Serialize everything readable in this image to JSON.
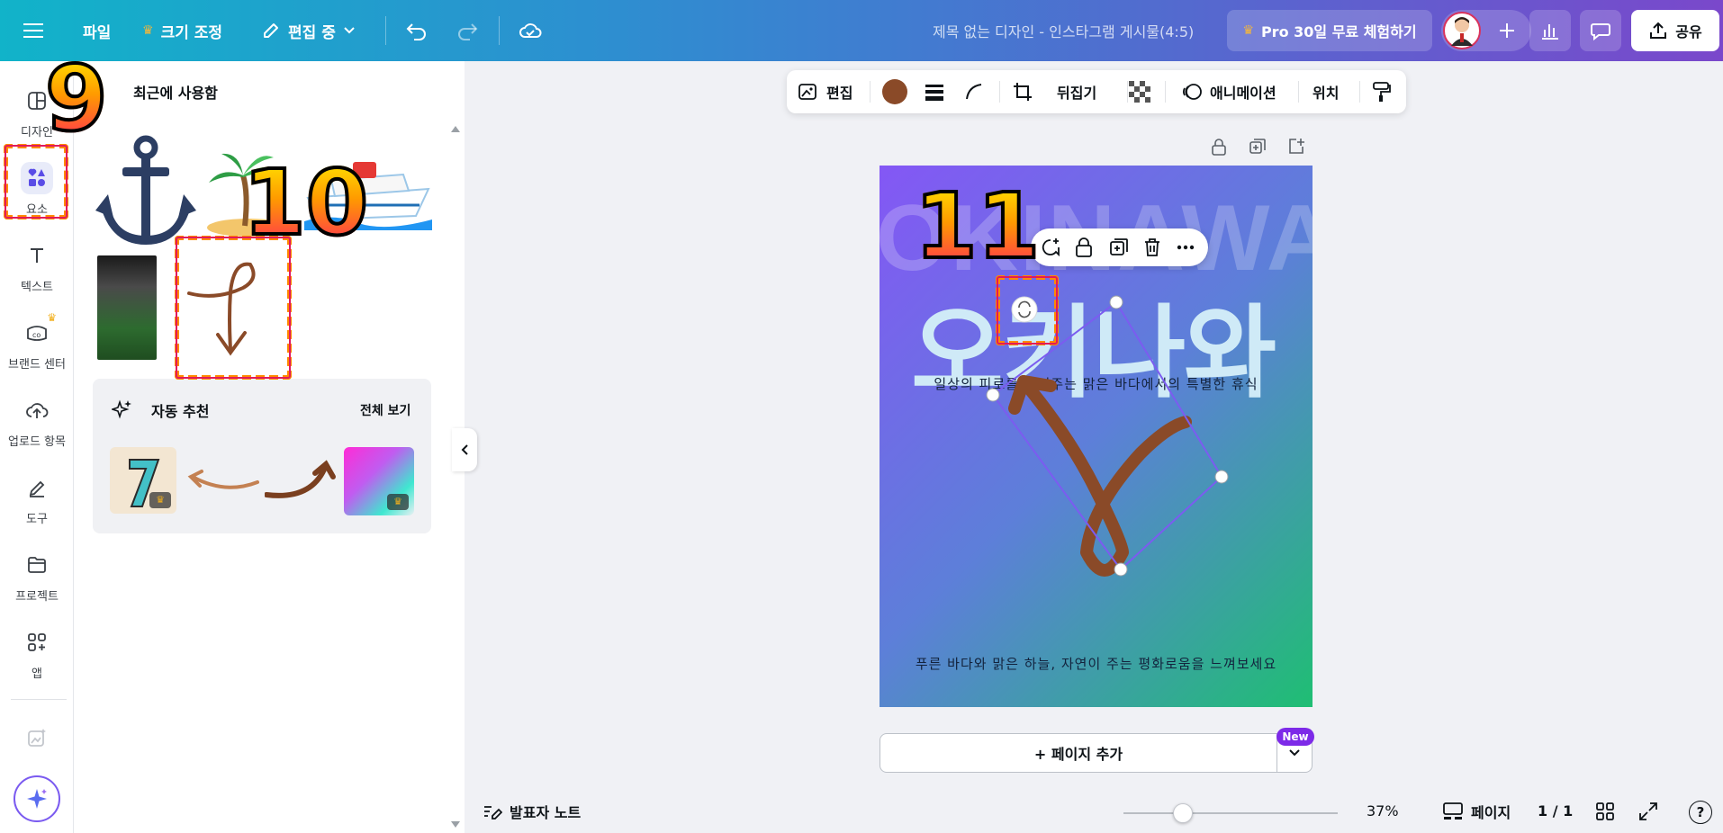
{
  "topbar": {
    "menu_label": "파일",
    "resize_label": "크기 조정",
    "editing_label": "편집 중",
    "doc_title": "제목 없는 디자인 - 인스타그램 게시물(4:5)",
    "pro_trial": "Pro 30일 무료 체험하기",
    "share_label": "공유"
  },
  "rail": {
    "items": [
      {
        "label": "디자인",
        "icon": "layout-icon"
      },
      {
        "label": "요소",
        "icon": "shapes-icon"
      },
      {
        "label": "텍스트",
        "icon": "text-icon"
      },
      {
        "label": "브랜드 센터",
        "icon": "brand-icon"
      },
      {
        "label": "업로드 항목",
        "icon": "cloud-upload-icon"
      },
      {
        "label": "도구",
        "icon": "pen-tool-icon"
      },
      {
        "label": "프로젝트",
        "icon": "folder-icon"
      },
      {
        "label": "앱",
        "icon": "apps-grid-icon"
      }
    ]
  },
  "panel": {
    "recent_title": "최근에 사용함",
    "auto_title": "자동 추천",
    "see_all": "전체 보기",
    "crown_color": "#f2b01e"
  },
  "toolbar": {
    "edit_label": "편집",
    "color": "#8a4a28",
    "flip_label": "뒤집기",
    "animate_label": "애니메이션",
    "position_label": "위치"
  },
  "design": {
    "bg_text": "OKINAWA",
    "title": "오키나와",
    "subtitle": "일상의 피로를 씻어주는 맑은 바다에서의 특별한 휴식",
    "bottom_text": "푸른 바다와 맑은 하늘, 자연이 주는 평화로움을 느껴보세요",
    "gradient_start": "#8457f5",
    "gradient_end": "#1fbe73"
  },
  "add_page": {
    "label": "+ 페이지 추가",
    "new_badge": "New"
  },
  "bottom": {
    "notes_label": "발표자 노트",
    "zoom": "37%",
    "zoom_fraction": 0.37,
    "pages_label": "페이지",
    "page_count": "1 / 1",
    "help": "?"
  },
  "annotations": [
    "9",
    "10",
    "11"
  ]
}
